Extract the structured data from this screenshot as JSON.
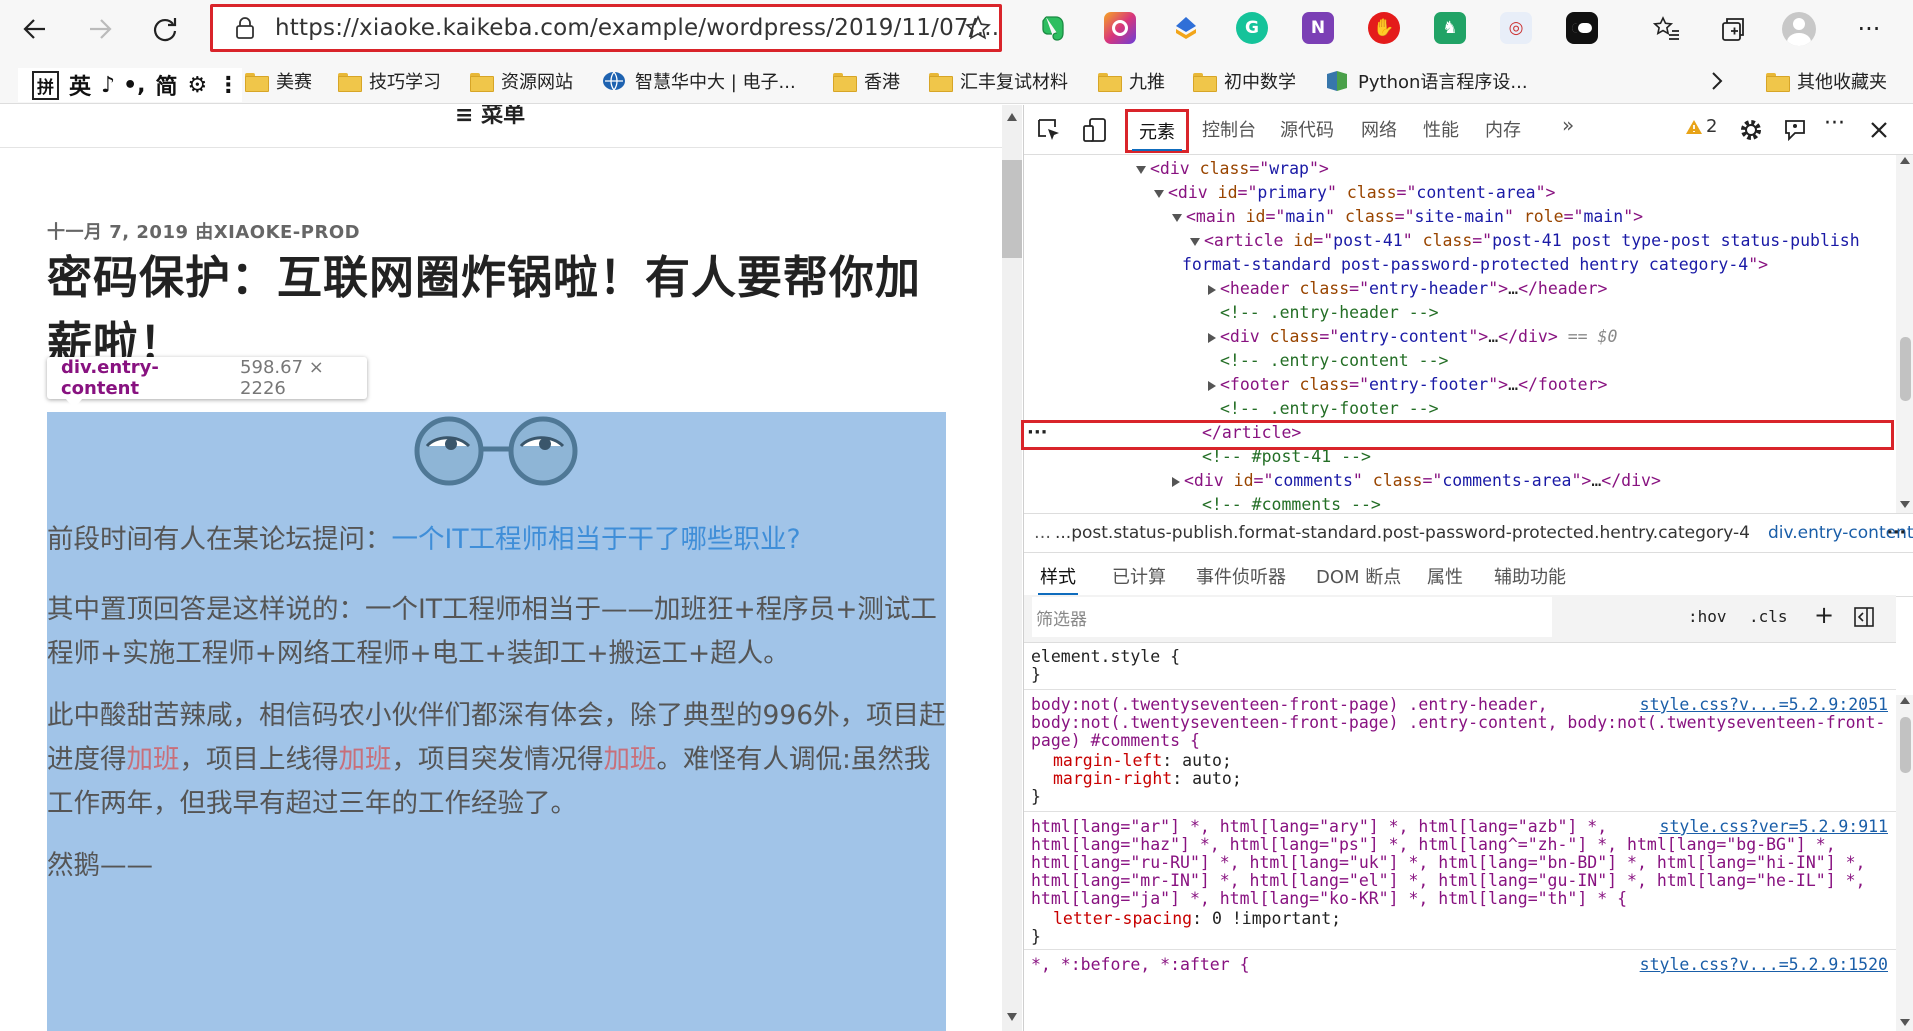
{
  "browser": {
    "url": "https://xiaoke.kaikeba.com/example/wordpress/2019/11/07/...",
    "extensions": [
      "evernote-icon",
      "screenshot-icon",
      "share-icon",
      "grammarly-icon",
      "onenote-icon",
      "adblock-icon",
      "ext-green-icon",
      "ext-glasses-icon",
      "ext-mask-icon"
    ]
  },
  "bookmarks": {
    "items": [
      {
        "label": "美赛",
        "icon": "folder-icon"
      },
      {
        "label": "技巧学习",
        "icon": "folder-icon"
      },
      {
        "label": "资源网站",
        "icon": "folder-icon"
      },
      {
        "label": "智慧华中大 | 电子...",
        "icon": "globe-icon"
      },
      {
        "label": "香港",
        "icon": "folder-icon"
      },
      {
        "label": "汇丰复试材料",
        "icon": "folder-icon"
      },
      {
        "label": "九推",
        "icon": "folder-icon"
      },
      {
        "label": "初中数学",
        "icon": "folder-icon"
      },
      {
        "label": "Python语言程序设...",
        "icon": "python-icon"
      }
    ],
    "other": "其他收藏夹"
  },
  "ime": {
    "chars": [
      "拼",
      "英",
      "♪",
      "•,",
      "简",
      "⚙",
      "⋮"
    ]
  },
  "page": {
    "menu": "≡ 菜单",
    "meta": "十一月 7, 2019 由XIAOKE-PROD",
    "title": "密码保护：互联网圈炸锅啦！有人要帮你加薪啦！",
    "tooltip": {
      "tag": "div.entry-content",
      "dims": "598.67 × 2226"
    },
    "p1_text": "前段时间有人在某论坛提问：",
    "p1_link": "一个IT工程师相当于干了哪些职业?",
    "p2": "其中置顶回答是这样说的：一个IT工程师相当于——加班狂+程序员+测试工程师+实施工程师+网络工程师+电工+装卸工+搬运工+超人。",
    "p3_a": "此中酸甜苦辣咸，相信码农小伙伴们都深有体会，除了典型的996外，项目赶进度得",
    "p3_b": "加班",
    "p3_c": "，项目上线得",
    "p3_d": "加班",
    "p3_e": "，项目突发情况得",
    "p3_f": "加班",
    "p3_g": "。难怪有人调侃:虽然我工作两年，但我早有超过三年的工作经验了。",
    "p4": "然鹅——"
  },
  "devtools": {
    "tabs": [
      "元素",
      "控制台",
      "源代码",
      "网络",
      "性能",
      "内存"
    ],
    "warnings": "2",
    "dom": [
      {
        "indent": 0,
        "tri": "down",
        "parts": [
          [
            "t",
            "<div "
          ],
          [
            "a",
            "class"
          ],
          [
            "t",
            "=\""
          ],
          [
            "v",
            "wrap"
          ],
          [
            "t",
            "\">"
          ]
        ]
      },
      {
        "indent": 1,
        "tri": "down",
        "parts": [
          [
            "t",
            "<div "
          ],
          [
            "a",
            "id"
          ],
          [
            "t",
            "=\""
          ],
          [
            "v",
            "primary"
          ],
          [
            "t",
            "\" "
          ],
          [
            "a",
            "class"
          ],
          [
            "t",
            "=\""
          ],
          [
            "v",
            "content-area"
          ],
          [
            "t",
            "\">"
          ]
        ]
      },
      {
        "indent": 2,
        "tri": "down",
        "parts": [
          [
            "t",
            "<main "
          ],
          [
            "a",
            "id"
          ],
          [
            "t",
            "=\""
          ],
          [
            "v",
            "main"
          ],
          [
            "t",
            "\" "
          ],
          [
            "a",
            "class"
          ],
          [
            "t",
            "=\""
          ],
          [
            "v",
            "site-main"
          ],
          [
            "t",
            "\" "
          ],
          [
            "a",
            "role"
          ],
          [
            "t",
            "=\""
          ],
          [
            "v",
            "main"
          ],
          [
            "t",
            "\">"
          ]
        ]
      },
      {
        "indent": 3,
        "tri": "down",
        "parts": [
          [
            "t",
            "<article "
          ],
          [
            "a",
            "id"
          ],
          [
            "t",
            "=\""
          ],
          [
            "v",
            "post-41"
          ],
          [
            "t",
            "\" "
          ],
          [
            "a",
            "class"
          ],
          [
            "t",
            "=\""
          ],
          [
            "v",
            "post-41 post type-post status-publish"
          ]
        ]
      },
      {
        "indent": 3,
        "tri": "",
        "parts": [
          [
            "v",
            "format-standard post-password-protected hentry category-4"
          ],
          [
            "t",
            "\">"
          ]
        ]
      },
      {
        "indent": 4,
        "tri": "right",
        "parts": [
          [
            "t",
            "<header "
          ],
          [
            "a",
            "class"
          ],
          [
            "t",
            "=\""
          ],
          [
            "v",
            "entry-header"
          ],
          [
            "t",
            "\">"
          ],
          [
            "x",
            "…"
          ],
          [
            "t",
            "</header>"
          ]
        ]
      },
      {
        "indent": 4,
        "tri": "",
        "parts": [
          [
            "c",
            "<!-- .entry-header -->"
          ]
        ]
      },
      {
        "indent": 4,
        "tri": "right",
        "parts": [
          [
            "t",
            "<div "
          ],
          [
            "a",
            "class"
          ],
          [
            "t",
            "=\""
          ],
          [
            "v",
            "entry-content"
          ],
          [
            "t",
            "\">"
          ],
          [
            "x",
            "…"
          ],
          [
            "t",
            "</div>"
          ],
          [
            "g",
            " == $0"
          ]
        ]
      },
      {
        "indent": 4,
        "tri": "",
        "parts": [
          [
            "c",
            "<!-- .entry-content -->"
          ]
        ]
      },
      {
        "indent": 4,
        "tri": "right",
        "parts": [
          [
            "t",
            "<footer "
          ],
          [
            "a",
            "class"
          ],
          [
            "t",
            "=\""
          ],
          [
            "v",
            "entry-footer"
          ],
          [
            "t",
            "\">"
          ],
          [
            "x",
            "…"
          ],
          [
            "t",
            "</footer>"
          ]
        ]
      },
      {
        "indent": 4,
        "tri": "",
        "parts": [
          [
            "c",
            "<!-- .entry-footer -->"
          ]
        ]
      },
      {
        "indent": 3,
        "tri": "",
        "parts": [
          [
            "t",
            "</article>"
          ]
        ]
      },
      {
        "indent": 3,
        "tri": "",
        "parts": [
          [
            "c",
            "<!-- #post-41 -->"
          ]
        ]
      },
      {
        "indent": 2,
        "tri": "right",
        "parts": [
          [
            "t",
            "<div "
          ],
          [
            "a",
            "id"
          ],
          [
            "t",
            "=\""
          ],
          [
            "v",
            "comments"
          ],
          [
            "t",
            "\" "
          ],
          [
            "a",
            "class"
          ],
          [
            "t",
            "=\""
          ],
          [
            "v",
            "comments-area"
          ],
          [
            "t",
            "\">"
          ],
          [
            "x",
            "…"
          ],
          [
            "t",
            "</div>"
          ]
        ]
      },
      {
        "indent": 3,
        "tri": "",
        "parts": [
          [
            "c",
            "<!-- #comments -->"
          ]
        ]
      }
    ],
    "crumb_path": "...post.status-publish.format-standard.post-password-protected.hentry.category-4",
    "crumb_current": "div.entry-content",
    "subtabs": [
      "样式",
      "已计算",
      "事件侦听器",
      "DOM 断点",
      "属性",
      "辅助功能"
    ],
    "filter_placeholder": "筛选器",
    "hov": ":hov",
    "cls": ".cls",
    "styles": {
      "element_style": [
        "element.style {",
        "}"
      ],
      "rule1_src": "style.css?v...=5.2.9:2051",
      "rule1_sel1": "body:not(.twentyseventeen-front-page) .entry-header,",
      "rule1_sel2": "body:not(.twentyseventeen-front-page) .entry-content, body:not(.twentyseventeen-front-",
      "rule1_sel3": "page) #comments {",
      "rule1_p1n": "margin-left",
      "rule1_p1v": "auto;",
      "rule1_p2n": "margin-right",
      "rule1_p2v": "auto;",
      "rule2_src": "style.css?ver=5.2.9:911",
      "rule2_sel": [
        "html[lang=\"ar\"] *, html[lang=\"ary\"] *, html[lang=\"azb\"] *,",
        "html[lang=\"haz\"] *, html[lang=\"ps\"] *, html[lang^=\"zh-\"] *, html[lang=\"bg-BG\"] *,",
        "html[lang=\"ru-RU\"] *, html[lang=\"uk\"] *, html[lang=\"bn-BD\"] *, html[lang=\"hi-IN\"] *,",
        "html[lang=\"mr-IN\"] *, html[lang=\"el\"] *, html[lang=\"gu-IN\"] *, html[lang=\"he-IL\"] *,",
        "html[lang=\"ja\"] *, html[lang=\"ko-KR\"] *, html[lang=\"th\"] * {"
      ],
      "rule2_pn": "letter-spacing",
      "rule2_pv": "0 !important;",
      "rule3_sel": "*, *:before, *:after {",
      "rule3_src": "style.css?v...=5.2.9:1520"
    }
  }
}
